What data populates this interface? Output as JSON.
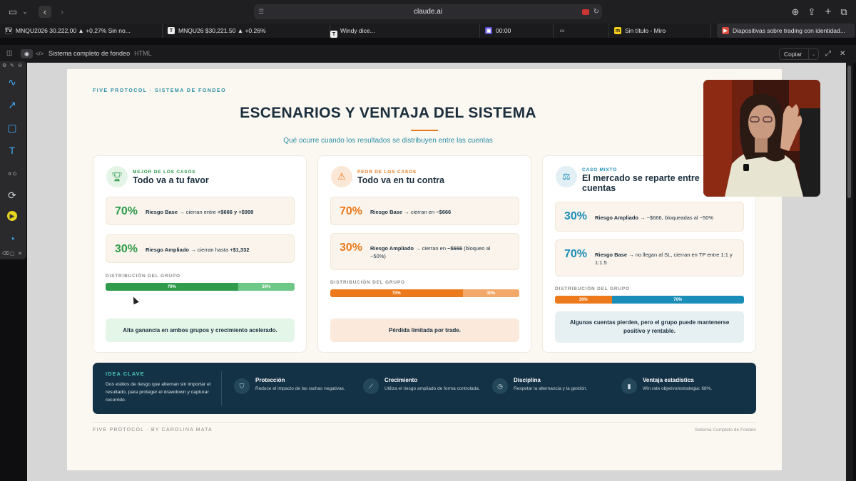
{
  "browser": {
    "url": "claude.ai",
    "tabs": [
      {
        "icon": "TV",
        "label": "MNQU2026 30.222,00 ▲ +0.27% Sin no..."
      },
      {
        "icon": "T",
        "label": "MNQU26 $30,221.50 ▲ +0.26%"
      },
      {
        "icon": "T",
        "label": "Windy dice..."
      },
      {
        "icon": "▣",
        "label": "00:00"
      },
      {
        "icon": "▭",
        "label": ""
      },
      {
        "icon": "m",
        "label": "Sin título - Miro"
      },
      {
        "icon": "▶",
        "label": "Diapositivas sobre trading con identidad..."
      }
    ]
  },
  "artifact": {
    "title": "Sistema completo de fondeo",
    "type": "HTML",
    "copy_label": "Copiar"
  },
  "page": {
    "brand": "FIVE PROTOCOL · SISTEMA DE FONDEO",
    "title": "ESCENARIOS Y VENTAJA DEL SISTEMA",
    "subtitle": "Qué ocurre cuando los resultados se distribuyen entre las cuentas",
    "dist_label": "DISTRIBUCIÓN DEL GRUPO",
    "cards": [
      {
        "kicker": "MEJOR DE LOS CASOS",
        "title": "Todo va a tu favor",
        "icon": "trophy-icon",
        "rows": [
          {
            "pct": "70%",
            "name": "Riesgo Base",
            "text": " → cierran entre ",
            "bold": "+$666 y +$999",
            "tail": ""
          },
          {
            "pct": "30%",
            "name": "Riesgo Ampliado",
            "text": " → cierran hasta ",
            "bold": "+$1,332",
            "tail": ""
          }
        ],
        "bar": [
          {
            "label": "70%",
            "share": 70
          },
          {
            "label": "30%",
            "share": 30
          }
        ],
        "note": "Alta ganancia en ambos grupos y crecimiento acelerado."
      },
      {
        "kicker": "PEOR DE LOS CASOS",
        "title": "Todo va en tu contra",
        "icon": "warning-icon",
        "rows": [
          {
            "pct": "70%",
            "name": "Riesgo Base",
            "text": " → cierran en ",
            "bold": "−$666",
            "tail": ""
          },
          {
            "pct": "30%",
            "name": "Riesgo Ampliado",
            "text": " → cierran en ",
            "bold": "−$666",
            "tail": " (bloqueo al −50%)"
          }
        ],
        "bar": [
          {
            "label": "70%",
            "share": 70
          },
          {
            "label": "30%",
            "share": 30
          }
        ],
        "note": "Pérdida limitada por trade."
      },
      {
        "kicker": "CASO MIXTO",
        "title": "El mercado se reparte entre cuentas",
        "icon": "scale-icon",
        "rows": [
          {
            "pct": "30%",
            "name": "Riesgo Ampliado",
            "text": " → −$666, bloqueadas al −50%",
            "bold": "",
            "tail": ""
          },
          {
            "pct": "70%",
            "name": "Riesgo Base",
            "text": " → no llegan al SL, cierran en TP entre 1:1 y 1:1.5",
            "bold": "",
            "tail": ""
          }
        ],
        "bar": [
          {
            "label": "30%",
            "share": 30
          },
          {
            "label": "70%",
            "share": 70
          }
        ],
        "note": "Algunas cuentas pierden, pero el grupo puede mantenerse positivo y rentable."
      }
    ],
    "key": {
      "title": "IDEA CLAVE",
      "desc": "Dos estilos de riesgo que alternan sin importar el resultado, para proteger el drawdown y capturar recorrido.",
      "items": [
        {
          "icon": "shield-icon",
          "title": "Protección",
          "desc": "Reduce el impacto de las rachas negativas."
        },
        {
          "icon": "growth-icon",
          "title": "Crecimiento",
          "desc": "Utiliza el riesgo ampliado de forma controlada."
        },
        {
          "icon": "clock-icon",
          "title": "Disciplina",
          "desc": "Respetar la alternancia y la gestión."
        },
        {
          "icon": "bar-chart-icon",
          "title": "Ventaja estadística",
          "desc": "Win rate objetivo/estrategia: 68%."
        }
      ]
    },
    "footer_left": "FIVE PROTOCOL · BY CAROLINA MATA",
    "footer_right": "Sistema Completo de Fondeo"
  },
  "colors": {
    "green": "#2f9b4b",
    "green_light": "#6dc786",
    "orange": "#ec7a1c",
    "orange_light": "#f2a868",
    "teal": "#1a8db8",
    "navy": "#143245"
  }
}
